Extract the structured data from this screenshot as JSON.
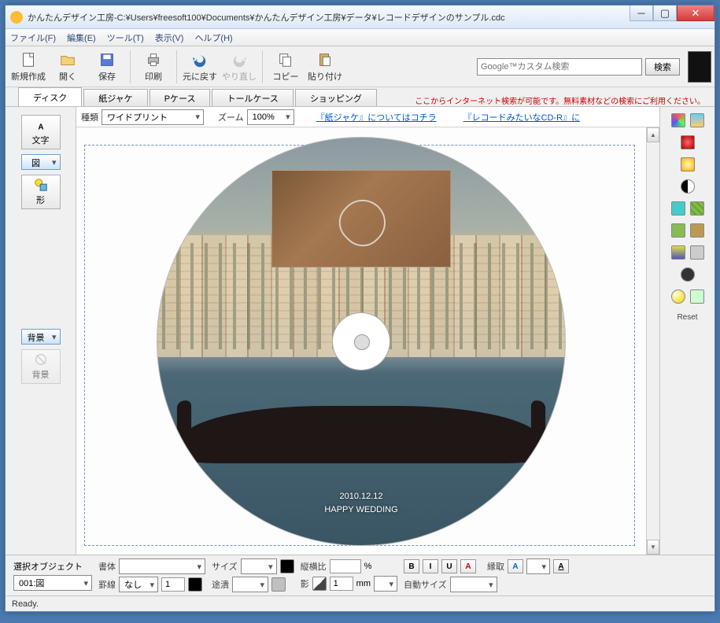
{
  "window": {
    "title": "かんたんデザイン工房-C:¥Users¥freesoft100¥Documents¥かんたんデザイン工房¥データ¥レコードデザインのサンプル.cdc"
  },
  "menu": {
    "file": "ファイル(F)",
    "edit": "編集(E)",
    "tools": "ツール(T)",
    "view": "表示(V)",
    "help": "ヘルプ(H)"
  },
  "toolbar": {
    "new": "新規作成",
    "open": "開く",
    "save": "保存",
    "print": "印刷",
    "undo": "元に戻す",
    "redo": "やり直し",
    "copy": "コピー",
    "paste": "貼り付け"
  },
  "search": {
    "placeholder": "Google™カスタム検索",
    "button": "検索"
  },
  "tabs": {
    "items": [
      "ディスク",
      "紙ジャケ",
      "Pケース",
      "トールケース",
      "ショッピング"
    ],
    "info": "ここからインターネット検索が可能です。無料素材などの検索にご利用ください。"
  },
  "lefttools": {
    "text": "文字",
    "image": "図",
    "shape": "形",
    "bg_on": "背景",
    "bg_off": "背景"
  },
  "options": {
    "type_label": "種類",
    "type_value": "ワイドプリント",
    "zoom_label": "ズーム",
    "zoom_value": "100%",
    "link1": "『紙ジャケ』についてはコチラ",
    "link2": "『レコードみたいなCD-R』に"
  },
  "disc": {
    "date": "2010.12.12",
    "caption": "HAPPY WEDDING"
  },
  "right": {
    "reset": "Reset"
  },
  "bottom": {
    "selobj_label": "選択オブジェクト",
    "selobj_value": "001:図",
    "font_label": "書体",
    "line_label": "罫線",
    "line_value": "なし",
    "size_label": "サイズ",
    "fill_label": "途潰",
    "ratio_label": "縦横比",
    "ratio_unit": "%",
    "shadow_label": "影",
    "shadow_value": "1",
    "shadow_unit": "mm",
    "b": "B",
    "i": "I",
    "u": "U",
    "a": "A",
    "stroke_label": "縁取",
    "auto_label": "自動サイズ",
    "line_width": "1"
  },
  "status": "Ready."
}
